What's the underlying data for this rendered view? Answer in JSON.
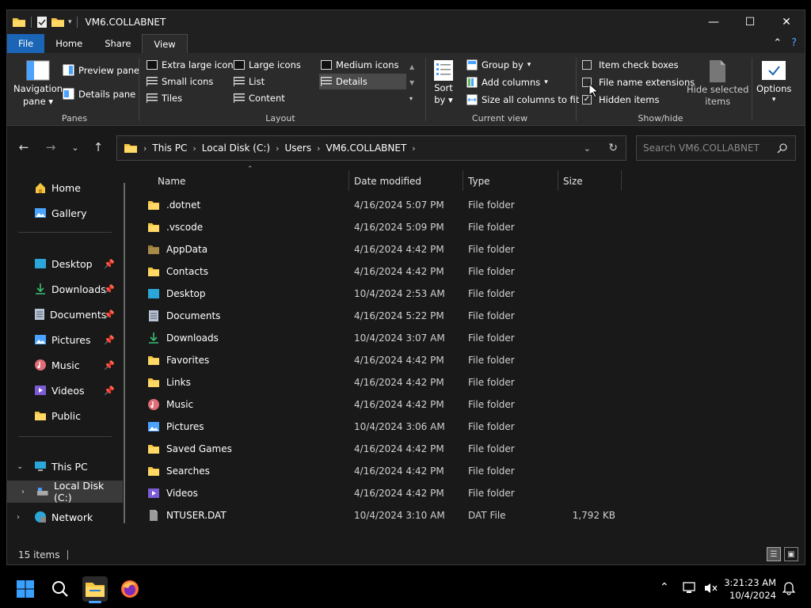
{
  "window": {
    "title": "VM6.COLLABNET"
  },
  "titlebar": {
    "minimize": "—",
    "maximize": "☐",
    "close": "✕"
  },
  "ribbon_tabs": [
    "File",
    "Home",
    "Share",
    "View"
  ],
  "ribbon": {
    "panes": {
      "navigation_pane": "Navigation",
      "navigation_pane_2": "pane",
      "preview_pane": "Preview pane",
      "details_pane": "Details pane",
      "label": "Panes"
    },
    "layout": {
      "extra_large_icons": "Extra large icons",
      "large_icons": "Large icons",
      "medium_icons": "Medium icons",
      "small_icons": "Small icons",
      "list": "List",
      "details": "Details",
      "tiles": "Tiles",
      "content": "Content",
      "label": "Layout",
      "selected": "Details"
    },
    "current_view": {
      "sort_by": "Sort",
      "sort_by_2": "by",
      "group_by": "Group by",
      "add_columns": "Add columns",
      "size_all_columns": "Size all columns to fit",
      "label": "Current view"
    },
    "show_hide": {
      "item_check_boxes": "Item check boxes",
      "file_name_extensions": "File name extensions",
      "hidden_items": "Hidden items",
      "hide_selected": "Hide selected",
      "hide_selected_2": "items",
      "label": "Show/hide",
      "item_check_boxes_checked": false,
      "file_name_extensions_checked": false,
      "hidden_items_checked": true
    },
    "options": {
      "label": "Options"
    }
  },
  "address": {
    "crumbs": [
      "This PC",
      "Local Disk (C:)",
      "Users",
      "VM6.COLLABNET"
    ]
  },
  "search": {
    "placeholder": "Search VM6.COLLABNET"
  },
  "nav": {
    "items": [
      {
        "label": "Home",
        "icon": "home-icon"
      },
      {
        "label": "Gallery",
        "icon": "gallery-icon"
      },
      {
        "label": "Desktop",
        "icon": "desktop-icon"
      },
      {
        "label": "Downloads",
        "icon": "downloads-icon"
      },
      {
        "label": "Documents",
        "icon": "documents-icon"
      },
      {
        "label": "Pictures",
        "icon": "pictures-icon"
      },
      {
        "label": "Music",
        "icon": "music-icon"
      },
      {
        "label": "Videos",
        "icon": "videos-icon"
      },
      {
        "label": "Public",
        "icon": "folder-icon"
      },
      {
        "label": "This PC",
        "icon": "this-pc-icon"
      },
      {
        "label": "Local Disk (C:)",
        "icon": "drive-icon"
      },
      {
        "label": "Network",
        "icon": "network-icon"
      }
    ]
  },
  "columns": {
    "name": "Name",
    "date": "Date modified",
    "type": "Type",
    "size": "Size"
  },
  "files": [
    {
      "name": ".dotnet",
      "date": "4/16/2024 5:07 PM",
      "type": "File folder",
      "size": "",
      "icon": "folder-icon"
    },
    {
      "name": ".vscode",
      "date": "4/16/2024 5:09 PM",
      "type": "File folder",
      "size": "",
      "icon": "folder-icon"
    },
    {
      "name": "AppData",
      "date": "4/16/2024 4:42 PM",
      "type": "File folder",
      "size": "",
      "icon": "folder-hidden-icon"
    },
    {
      "name": "Contacts",
      "date": "4/16/2024 4:42 PM",
      "type": "File folder",
      "size": "",
      "icon": "folder-icon"
    },
    {
      "name": "Desktop",
      "date": "10/4/2024 2:53 AM",
      "type": "File folder",
      "size": "",
      "icon": "desktop-icon"
    },
    {
      "name": "Documents",
      "date": "4/16/2024 5:22 PM",
      "type": "File folder",
      "size": "",
      "icon": "documents-icon"
    },
    {
      "name": "Downloads",
      "date": "10/4/2024 3:07 AM",
      "type": "File folder",
      "size": "",
      "icon": "downloads-icon"
    },
    {
      "name": "Favorites",
      "date": "4/16/2024 4:42 PM",
      "type": "File folder",
      "size": "",
      "icon": "folder-icon"
    },
    {
      "name": "Links",
      "date": "4/16/2024 4:42 PM",
      "type": "File folder",
      "size": "",
      "icon": "folder-icon"
    },
    {
      "name": "Music",
      "date": "4/16/2024 4:42 PM",
      "type": "File folder",
      "size": "",
      "icon": "music-icon"
    },
    {
      "name": "Pictures",
      "date": "10/4/2024 3:06 AM",
      "type": "File folder",
      "size": "",
      "icon": "pictures-icon"
    },
    {
      "name": "Saved Games",
      "date": "4/16/2024 4:42 PM",
      "type": "File folder",
      "size": "",
      "icon": "folder-icon"
    },
    {
      "name": "Searches",
      "date": "4/16/2024 4:42 PM",
      "type": "File folder",
      "size": "",
      "icon": "folder-icon"
    },
    {
      "name": "Videos",
      "date": "4/16/2024 4:42 PM",
      "type": "File folder",
      "size": "",
      "icon": "videos-icon"
    },
    {
      "name": "NTUSER.DAT",
      "date": "10/4/2024 3:10 AM",
      "type": "DAT File",
      "size": "1,792 KB",
      "icon": "file-icon"
    }
  ],
  "status": {
    "count": "15 items"
  },
  "taskbar": {
    "time": "3:21:23 AM",
    "date": "10/4/2024"
  },
  "colors": {
    "accent": "#1a65b5",
    "folder": "#f4c542",
    "background": "#191919"
  }
}
